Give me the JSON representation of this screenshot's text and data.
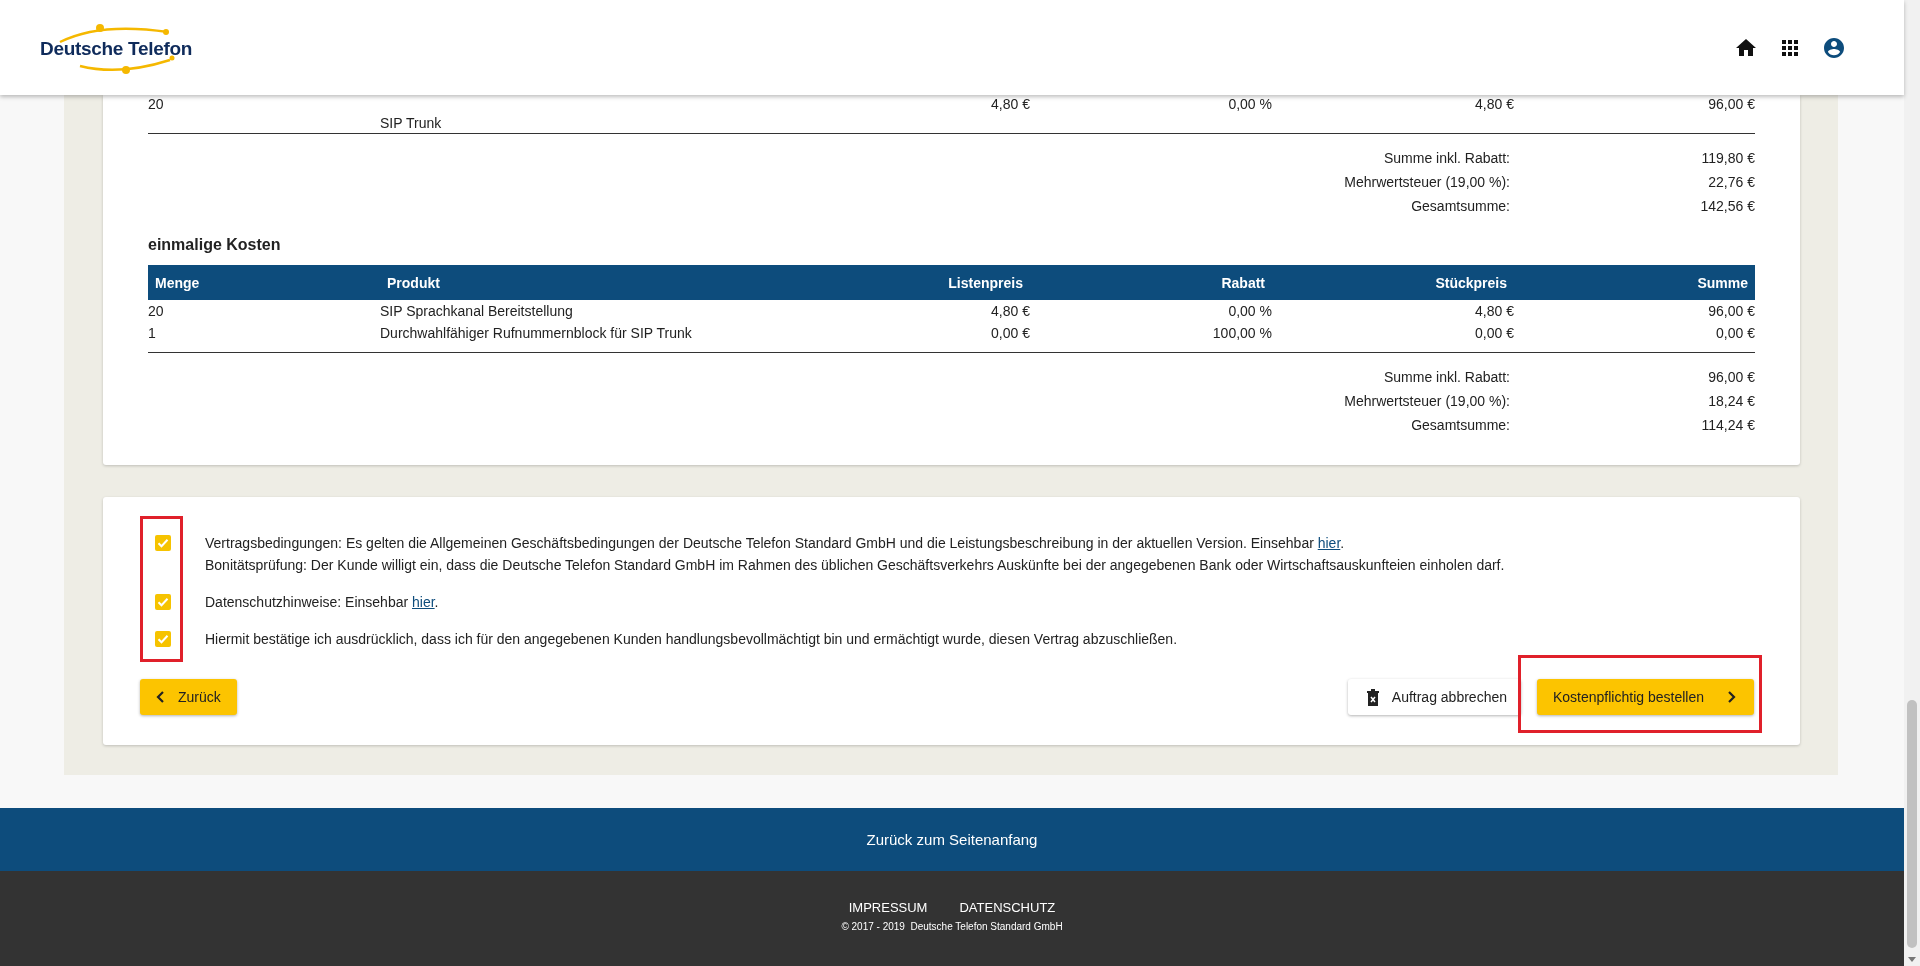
{
  "header": {
    "logo_text": "Deutsche Telefon"
  },
  "monthly_costs": {
    "rows": [
      {
        "quantity": "20",
        "product": "SIP Trunk",
        "list_price": "4,80 €",
        "discount": "0,00 %",
        "unit_price": "4,80 €",
        "total": "96,00 €"
      }
    ],
    "totals": [
      {
        "label": "Summe inkl. Rabatt:",
        "value": "119,80 €"
      },
      {
        "label": "Mehrwertsteuer (19,00 %):",
        "value": "22,76 €"
      },
      {
        "label": "Gesamtsumme:",
        "value": "142,56 €"
      }
    ]
  },
  "one_time_costs": {
    "title": "einmalige Kosten",
    "columns": [
      "Menge",
      "Produkt",
      "Listenpreis",
      "Rabatt",
      "Stückpreis",
      "Summe"
    ],
    "rows": [
      {
        "quantity": "20",
        "product": "SIP Sprachkanal Bereitstellung",
        "list_price": "4,80 €",
        "discount": "0,00 %",
        "unit_price": "4,80 €",
        "total": "96,00 €"
      },
      {
        "quantity": "1",
        "product": "Durchwahlfähiger Rufnummernblock für SIP Trunk",
        "list_price": "0,00 €",
        "discount": "100,00 %",
        "unit_price": "0,00 €",
        "total": "0,00 €"
      }
    ],
    "totals": [
      {
        "label": "Summe inkl. Rabatt:",
        "value": "96,00 €"
      },
      {
        "label": "Mehrwertsteuer (19,00 %):",
        "value": "18,24 €"
      },
      {
        "label": "Gesamtsumme:",
        "value": "114,24 €"
      }
    ]
  },
  "consents": [
    {
      "checked": true,
      "paragraphs": [
        {
          "text": "Vertragsbedingungen: Es gelten die Allgemeinen Geschäftsbedingungen der Deutsche Telefon Standard GmbH und die Leistungsbeschreibung in der aktuellen Version. Einsehbar ",
          "link": "hier",
          "suffix": "."
        },
        {
          "text": "Bonitätsprüfung: Der Kunde willigt ein, dass die Deutsche Telefon Standard GmbH im Rahmen des üblichen Geschäftsverkehrs Auskünfte bei der angegebenen Bank oder Wirtschaftsauskunfteien einholen darf."
        }
      ]
    },
    {
      "checked": true,
      "paragraphs": [
        {
          "text": "Datenschutzhinweise: Einsehbar ",
          "link": "hier",
          "suffix": "."
        }
      ]
    },
    {
      "checked": true,
      "paragraphs": [
        {
          "text": "Hiermit bestätige ich ausdrücklich, dass ich für den angegebenen Kunden handlungsbevollmächtigt bin und ermächtigt wurde, diesen Vertrag abzuschließen."
        }
      ]
    }
  ],
  "buttons": {
    "back": "Zurück",
    "cancel": "Auftrag abbrechen",
    "order": "Kostenpflichtig bestellen"
  },
  "footer": {
    "back_to_top": "Zurück zum Seitenanfang",
    "links": [
      "IMPRESSUM",
      "DATENSCHUTZ"
    ],
    "copyright": "© 2017 - 2019  Deutsche Telefon Standard GmbH"
  }
}
